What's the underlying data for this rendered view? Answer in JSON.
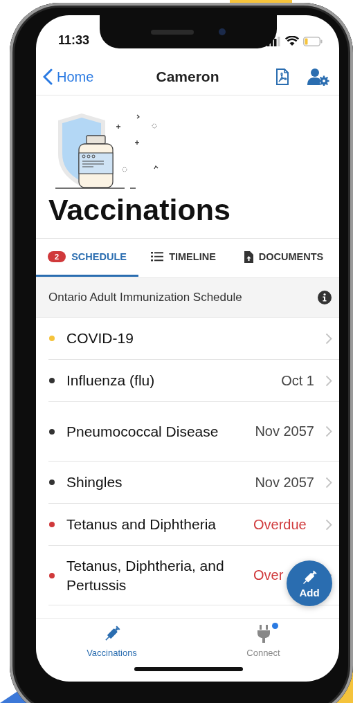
{
  "status_bar": {
    "time": "11:33"
  },
  "nav": {
    "back": "Home",
    "title": "Cameron"
  },
  "page_title": "Vaccinations",
  "tabs": [
    {
      "label": "SCHEDULE",
      "badge": "2",
      "selected": true
    },
    {
      "label": "TIMELINE",
      "selected": false
    },
    {
      "label": "DOCUMENTS",
      "selected": false
    }
  ],
  "schedule_header": "Ontario Adult Immunization Schedule",
  "vaccines": [
    {
      "name": "COVID-19",
      "color": "#f5c33b"
    },
    {
      "name": "Influenza (flu)",
      "due": "Oct 1",
      "color": "#333333",
      "overdue": false
    },
    {
      "name": "Pneumococcal Disease",
      "due": "Nov 2057",
      "color": "#333333",
      "overdue": false
    },
    {
      "name": "Shingles",
      "due": "Nov 2057",
      "color": "#333333",
      "overdue": false
    },
    {
      "name": "Tetanus and Diphtheria",
      "due": "Overdue",
      "color": "#d0393b",
      "overdue": true
    },
    {
      "name": "Tetanus, Diphtheria, and Pertussis",
      "due": "Over",
      "color": "#d0393b",
      "overdue": true
    }
  ],
  "fab": {
    "label": "Add"
  },
  "tab_bar": [
    {
      "label": "Vaccinations",
      "selected": true,
      "notification": false
    },
    {
      "label": "Connect",
      "selected": false,
      "notification": true
    }
  ]
}
